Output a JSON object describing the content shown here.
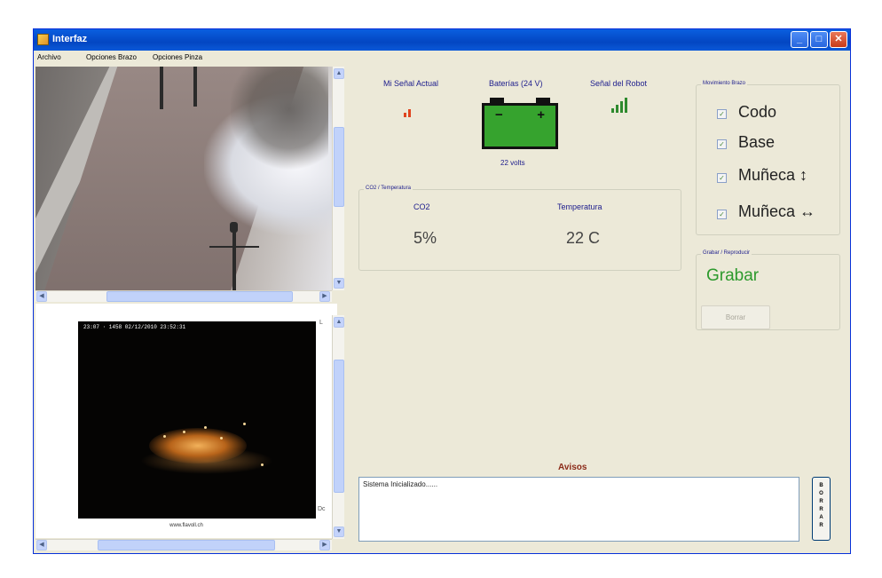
{
  "window": {
    "title": "Interfaz",
    "buttons": [
      "_",
      "□",
      "✕"
    ]
  },
  "menu": [
    "Archivo",
    "Opciones Brazo",
    "Opciones Pinza"
  ],
  "camera_bottom": {
    "overlay": "23:07 · 1458 02/12/2010 23:52:31",
    "caption": "www.flavoll.ch",
    "side_chars": [
      "L",
      "Dc"
    ]
  },
  "signal_mine": {
    "label": "Mi Señal Actual",
    "color": "#e0451f",
    "level": 0.4
  },
  "battery": {
    "label": "Baterías (24 V)",
    "minus": "−",
    "plus": "+",
    "volts": "22 volts",
    "color": "#36a32e"
  },
  "signal_robot": {
    "label": "Señal del Robot",
    "color": "#2e8a2e",
    "level": 1.0
  },
  "co2_temp": {
    "legend": "CO2 / Temperatura",
    "co2_label": "CO2",
    "co2_value": "5%",
    "temp_label": "Temperatura",
    "temp_value": "22 C"
  },
  "arm": {
    "legend": "Movimiento Brazo",
    "items": [
      {
        "label": "Codo",
        "checked": true
      },
      {
        "label": "Base",
        "checked": true
      },
      {
        "label": "Muñeca ↕",
        "checked": true
      },
      {
        "label": "Muñeca ↔",
        "checked": true
      }
    ]
  },
  "record": {
    "legend": "Grabar / Reproducir",
    "action": "Grabar",
    "clear_button": "Borrar",
    "action_color": "#2d9a2d"
  },
  "notices": {
    "title": "Avisos",
    "text": "Sistema Inicializado......",
    "clear_button": [
      "B",
      "O",
      "R",
      "R",
      "A",
      "R"
    ]
  }
}
